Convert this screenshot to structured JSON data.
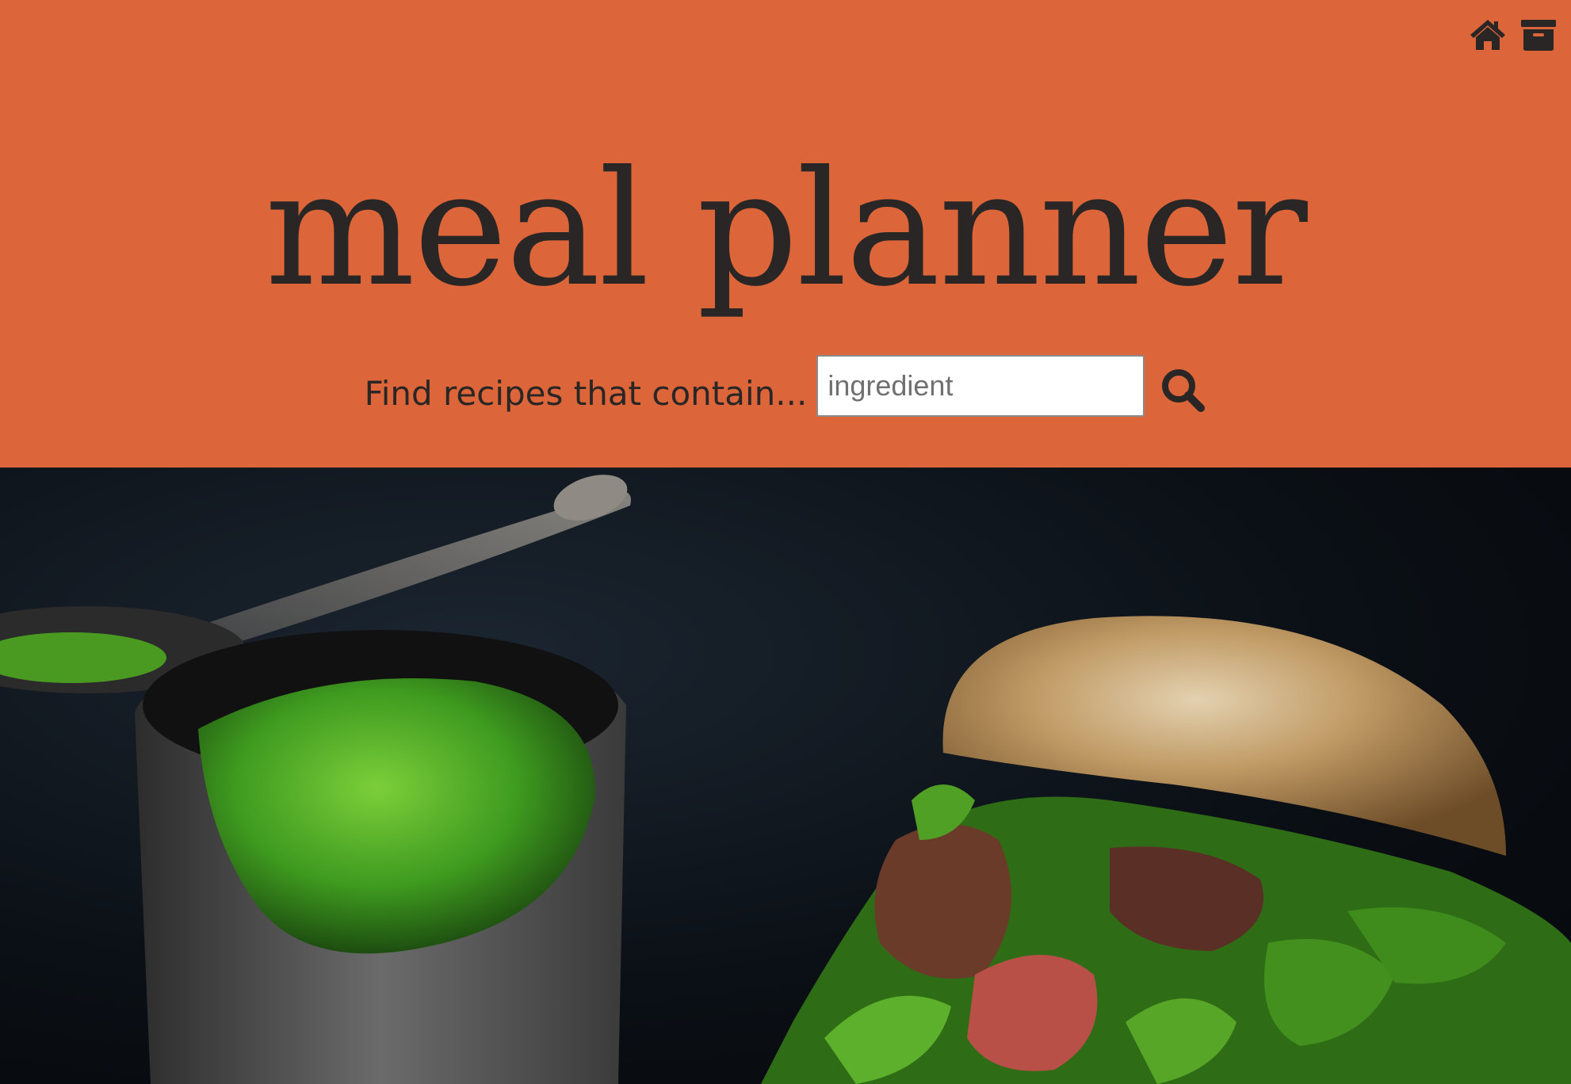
{
  "header": {
    "background_color": "#dc663a",
    "text_color": "#2a2625",
    "title": "meal planner",
    "icons": {
      "home": "home-icon",
      "archive": "archive-icon"
    }
  },
  "search": {
    "label": "Find recipes that contain...",
    "placeholder": "ingredient",
    "value": "",
    "button_icon": "search-icon"
  },
  "hero": {
    "description_icon": "food-photo"
  }
}
